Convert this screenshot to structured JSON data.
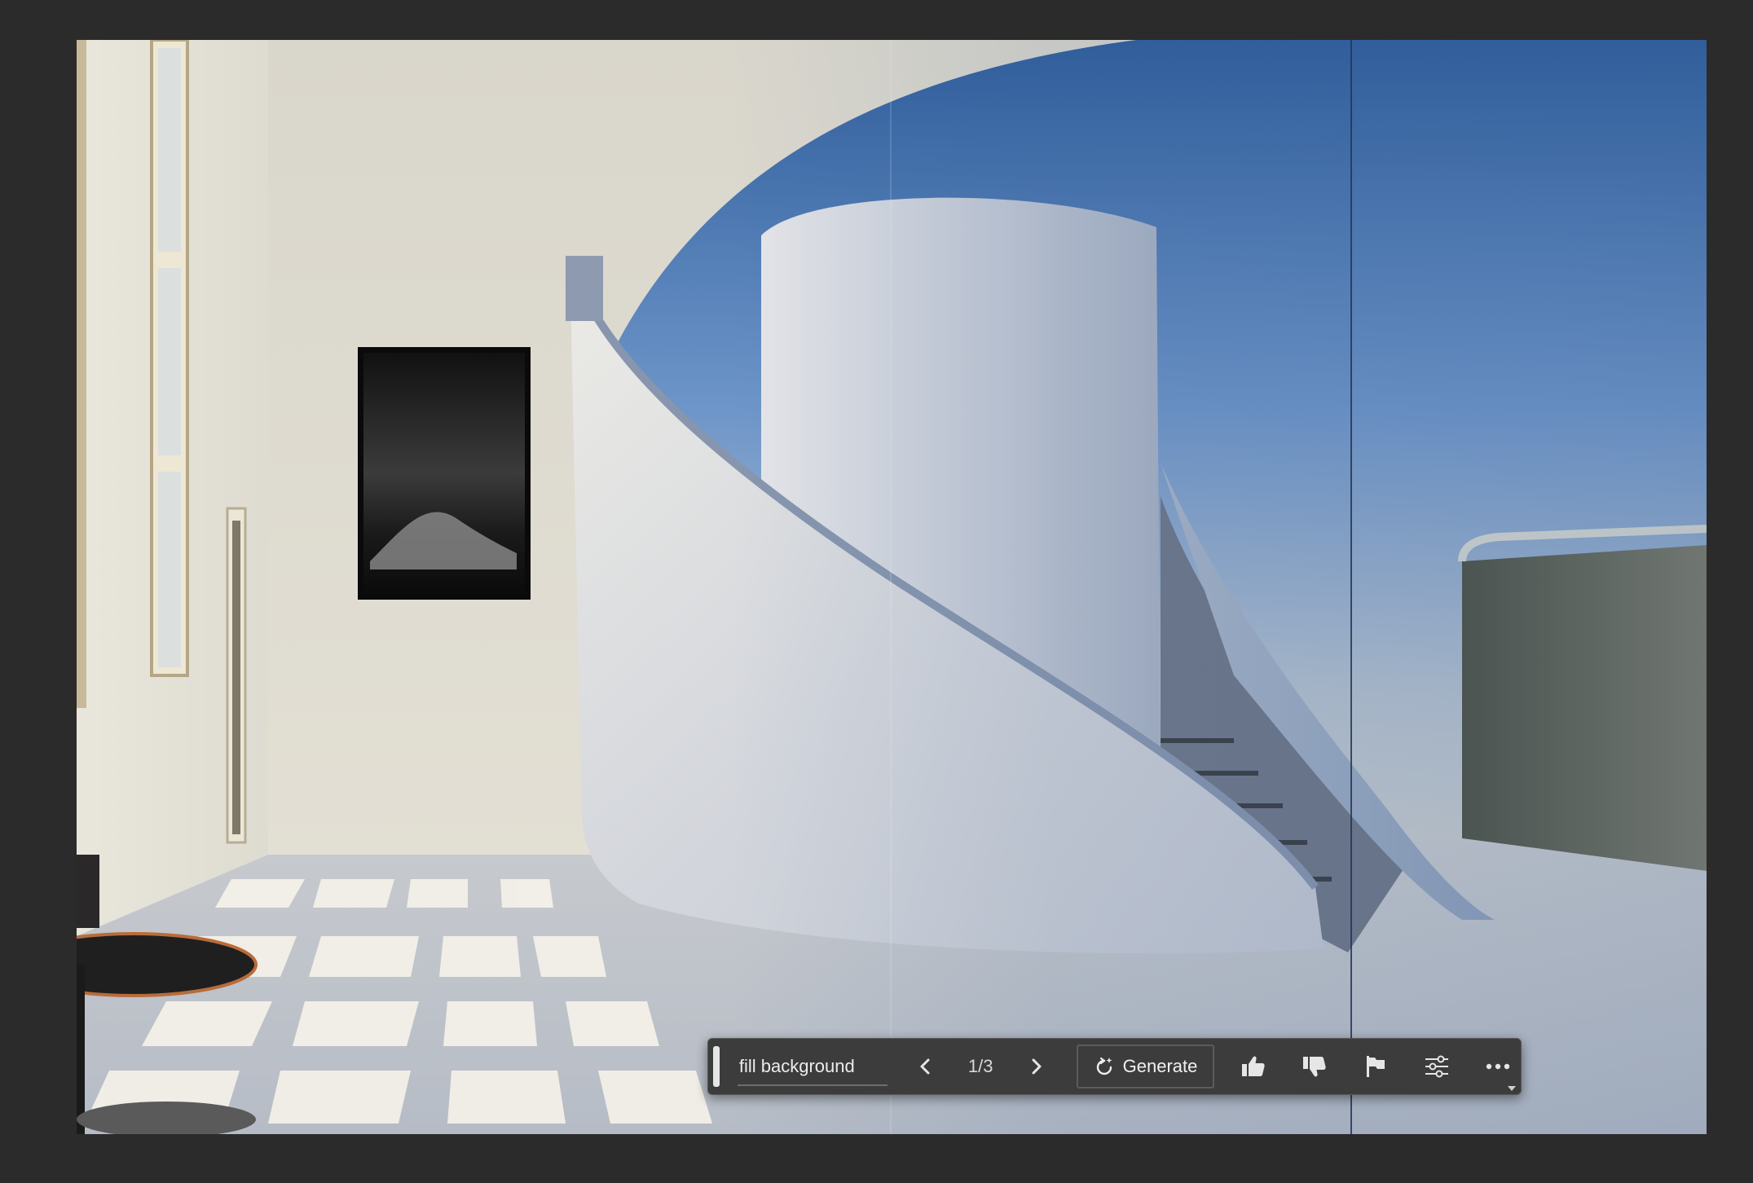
{
  "toolbar": {
    "prompt_text": "fill background",
    "variation_counter": "1/3",
    "generate_label": "Generate",
    "icons": {
      "previous": "chevron-left-icon",
      "next": "chevron-right-icon",
      "generate": "generate-refresh-icon",
      "like": "thumbs-up-icon",
      "dislike": "thumbs-down-icon",
      "report": "flag-icon",
      "properties": "sliders-icon",
      "more": "more-horizontal-icon"
    }
  },
  "colors": {
    "app_background": "#2b2b2b",
    "toolbar_background": "#3c3c3c",
    "toolbar_text": "#ececec"
  }
}
